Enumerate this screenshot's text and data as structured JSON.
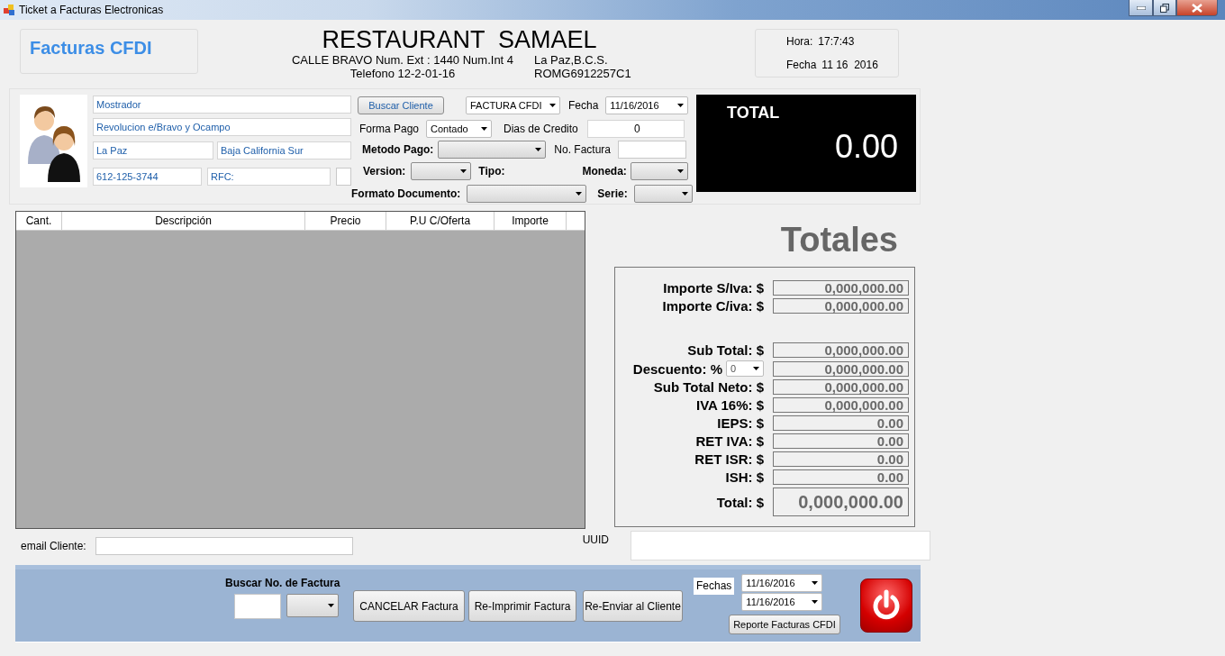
{
  "window": {
    "title": "Ticket a Facturas Electronicas"
  },
  "header": {
    "app_title": "Facturas CFDI",
    "restaurant_name": "RESTAURANT  SAMAEL",
    "address": "CALLE BRAVO Num. Ext : 1440 Num.Int 4",
    "city": "La Paz,B.C.S.",
    "phone": "Telefono 12-2-01-16",
    "rfc": "ROMG6912257C1",
    "time_label": "Hora:",
    "time": "17:7:43",
    "date_label": "Fecha",
    "date": "11 16  2016"
  },
  "client": {
    "name": "Mostrador",
    "address": "Revolucion e/Bravo y Ocampo",
    "city": "La Paz",
    "state": "Baja California Sur",
    "phone": "612-125-3744",
    "rfc": "RFC:",
    "search_button": "Buscar Cliente"
  },
  "invoice": {
    "doc_type": "FACTURA CFDI",
    "date_label": "Fecha",
    "date": "11/16/2016",
    "payment_form_label": "Forma Pago",
    "payment_form": "Contado",
    "credit_days_label": "Dias de Credito",
    "credit_days": "0",
    "payment_method_label": "Metodo Pago:",
    "invoice_number_label": "No. Factura",
    "version_label": "Version:",
    "type_label": "Tipo:",
    "currency_label": "Moneda:",
    "format_label": "Formato Documento:",
    "series_label": "Serie:"
  },
  "total": {
    "label": "TOTAL",
    "value": "0.00"
  },
  "table": {
    "columns": [
      "Cant.",
      "Descripción",
      "Precio",
      "P.U C/Oferta",
      "Importe"
    ]
  },
  "totals": {
    "title": "Totales",
    "import_rows": [
      {
        "label": "Importe S/Iva: $",
        "value": "0,000,000.00"
      },
      {
        "label": "Importe C/iva: $",
        "value": "0,000,000.00"
      }
    ],
    "rows": [
      {
        "kind": "plain",
        "label": "Sub Total: $",
        "value": "0,000,000.00"
      },
      {
        "kind": "discount",
        "label": "Descuento: %",
        "select": "0",
        "value": "0,000,000.00"
      },
      {
        "kind": "plain",
        "label": "Sub Total Neto: $",
        "value": "0,000,000.00"
      },
      {
        "kind": "plain",
        "label": "IVA 16%: $",
        "value": "0,000,000.00"
      },
      {
        "kind": "plain",
        "label": "IEPS: $",
        "value": "0.00"
      },
      {
        "kind": "plain",
        "label": "RET IVA: $",
        "value": "0.00"
      },
      {
        "kind": "plain",
        "label": "RET ISR: $",
        "value": "0.00"
      },
      {
        "kind": "plain",
        "label": "ISH: $",
        "value": "0.00"
      },
      {
        "kind": "grand",
        "label": "Total: $",
        "value": "0,000,000.00"
      }
    ]
  },
  "email": {
    "label": "email Cliente:"
  },
  "uuid": {
    "label": "UUID"
  },
  "bottom": {
    "search_label": "Buscar No. de Factura",
    "buttons": [
      "CANCELAR Factura",
      "Re-Imprimir Factura",
      "Re-Enviar al Cliente"
    ],
    "dates_label": "Fechas",
    "date_from": "11/16/2016",
    "date_to": "11/16/2016",
    "report_button": "Reporte Facturas CFDI"
  }
}
